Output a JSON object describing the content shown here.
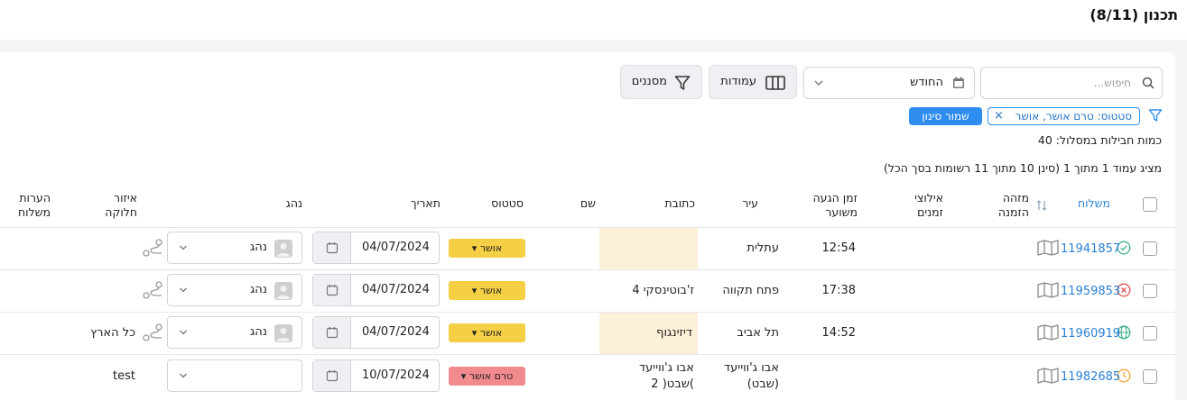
{
  "header": {
    "title": "תכנון (8/11)"
  },
  "toolbar": {
    "search_placeholder": "חיפוש...",
    "period_label": "החודש",
    "columns_label": "עמודות",
    "filters_label": "מסננים"
  },
  "filter": {
    "chip_label": "סטטוס: טרם אושר, אושר",
    "chip_close": "×",
    "save_label": "שמור סינון"
  },
  "info": {
    "packages_count": "כמות חבילות במסלול: 40",
    "page_info": "מציג עמוד 1 מתוך 1 (סינן 10 מתוך 11 רשומות בסך הכל)"
  },
  "columns": {
    "route": "משלוח",
    "order_id": "מזהה הזמנה",
    "time_constraints": "אילוצי זמנים",
    "eta": "זמן הגעה משוער",
    "city": "עיר",
    "address": "כתובת",
    "name": "שם",
    "status": "סטטוס",
    "date": "תאריך",
    "driver": "נהג",
    "zone": "איזור חלוקה",
    "notes": "הערות משלוח"
  },
  "rows": [
    {
      "status_icon": "check-circle-icon",
      "status_color": "#3bb08f",
      "id": "11941857",
      "eta": "12:54",
      "city": "עתלית",
      "address": "",
      "address_highlight": true,
      "status": "אושר",
      "status_kind": "ok",
      "date": "04/07/2024",
      "driver": "נהג",
      "has_driver_avatar": true,
      "zone": "",
      "notes": ""
    },
    {
      "status_icon": "x-circle-icon",
      "status_color": "#e05050",
      "id": "11959853",
      "eta": "17:38",
      "city": "פתח תקווה",
      "address": "ז'בוטינסקי 4",
      "address_highlight": false,
      "status": "אושר",
      "status_kind": "ok",
      "date": "04/07/2024",
      "driver": "נהג",
      "has_driver_avatar": true,
      "zone": "",
      "notes": ""
    },
    {
      "status_icon": "globe-icon",
      "status_color": "#3bb08f",
      "id": "11960919",
      "eta": "14:52",
      "city": "תל אביב",
      "address": "דיזינגוף",
      "address_highlight": true,
      "status": "אושר",
      "status_kind": "ok",
      "date": "04/07/2024",
      "driver": "נהג",
      "has_driver_avatar": true,
      "zone": "כל הארץ",
      "notes": ""
    },
    {
      "status_icon": "clock-icon",
      "status_color": "#f0a830",
      "id": "11982685",
      "eta": "",
      "city_line1": "אבו ג'ווייעד",
      "city_line2": "(שבט)",
      "address_line1": "אבו ג'ווייעד",
      "address_line2": ")שבט( 2",
      "address_highlight": false,
      "status": "טרם אושר",
      "status_kind": "pre",
      "date": "10/07/2024",
      "driver": "",
      "has_driver_avatar": false,
      "zone": "test",
      "notes": ""
    }
  ]
}
